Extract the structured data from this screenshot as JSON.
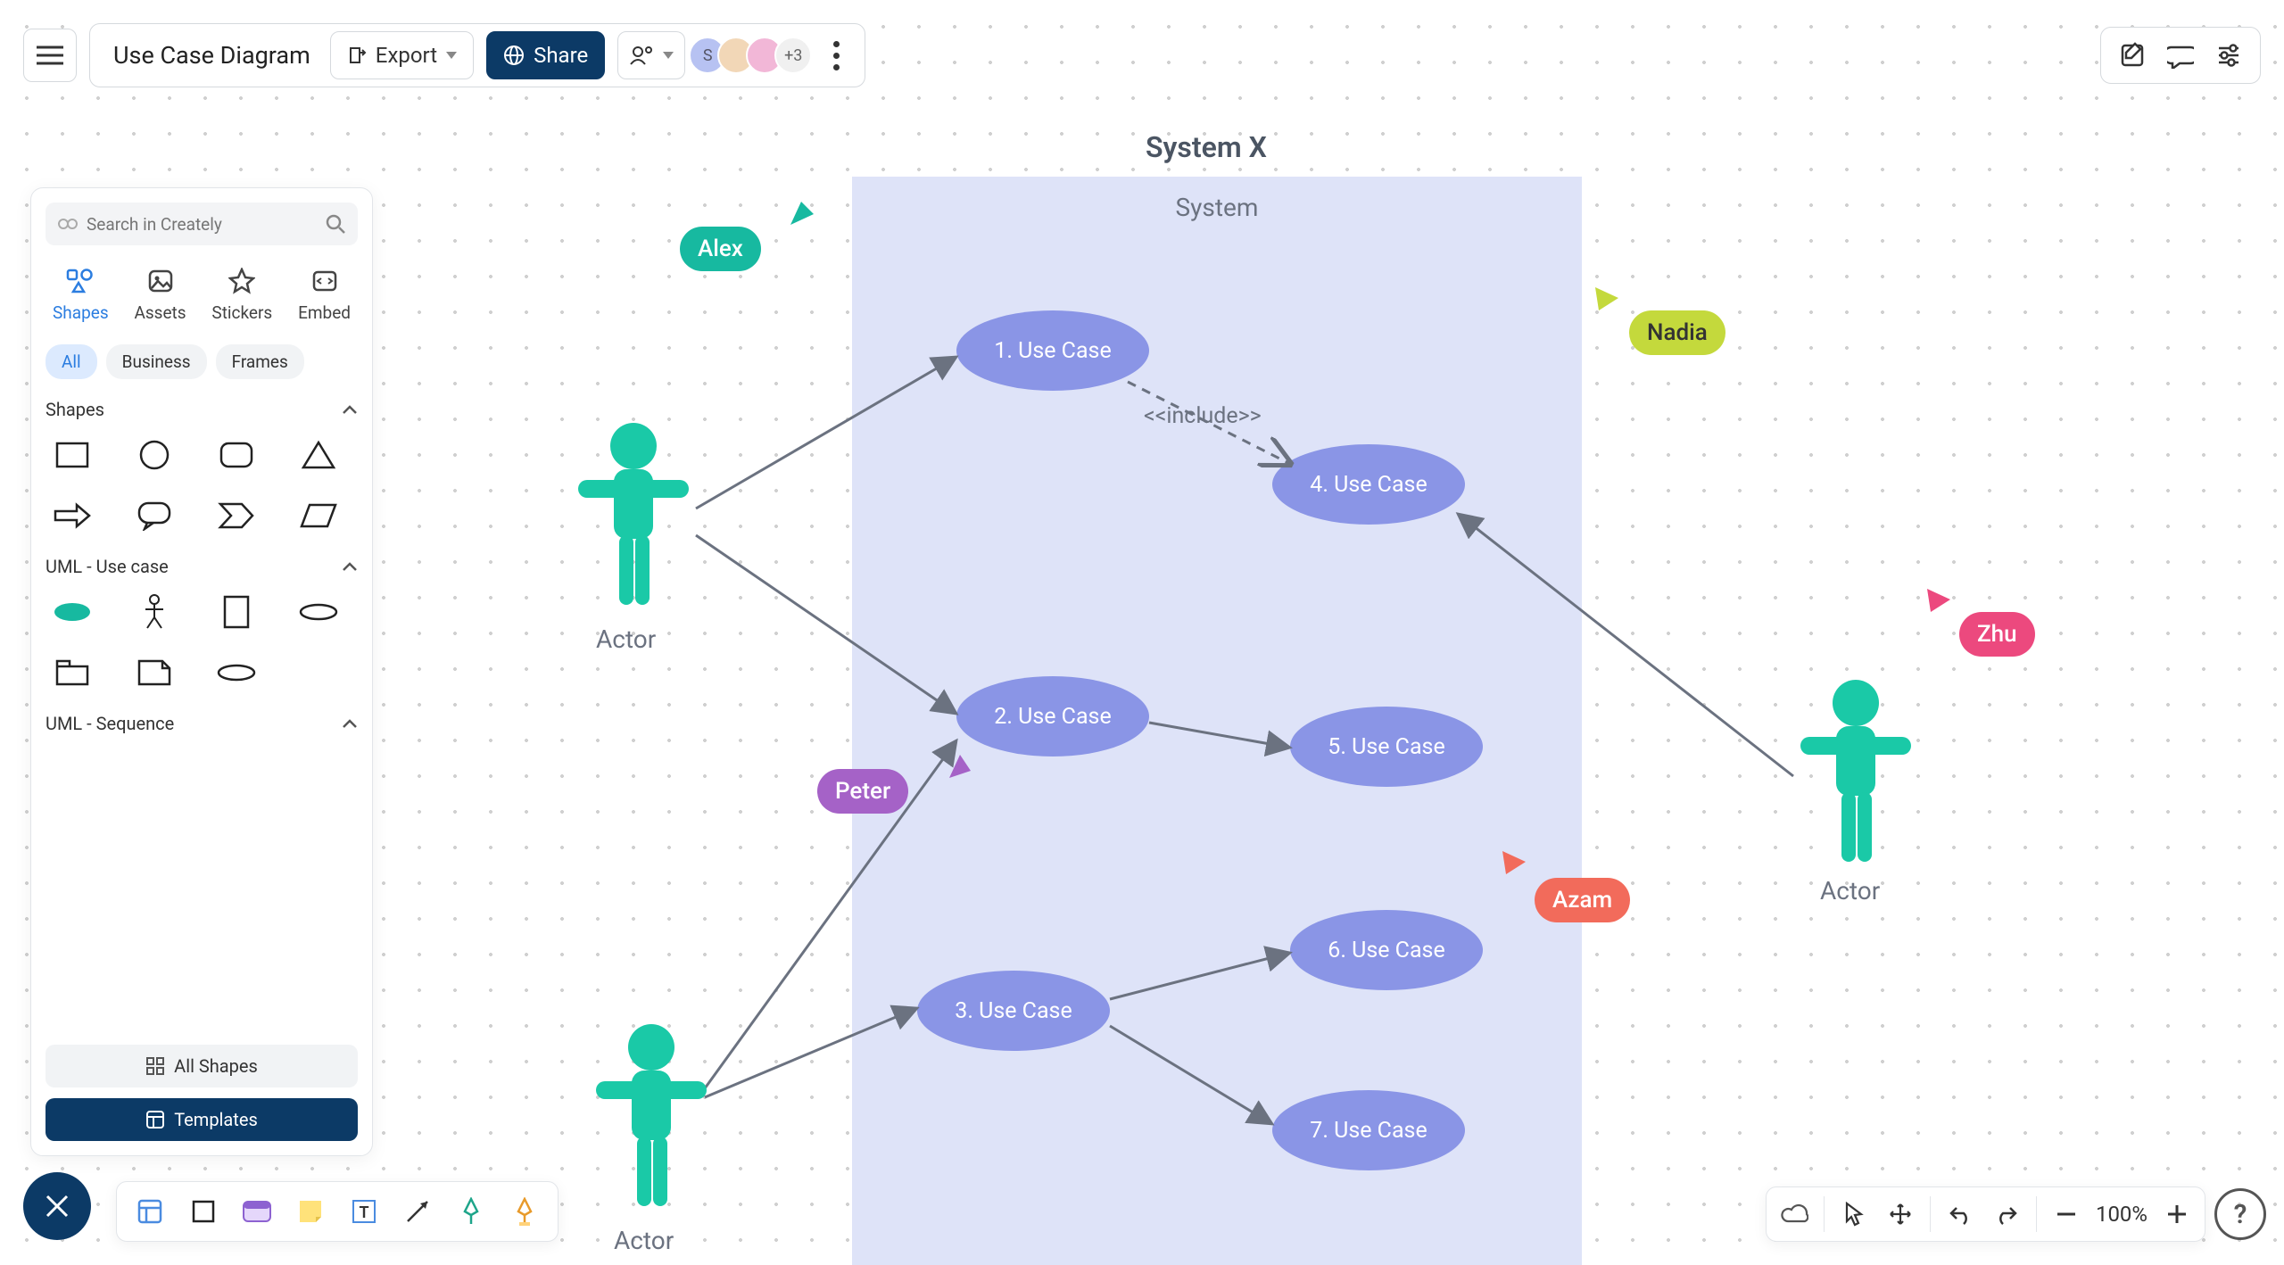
{
  "header": {
    "doc_title": "Use Case Diagram",
    "export_label": "Export",
    "share_label": "Share",
    "invite_label": "Invite",
    "avatars": [
      {
        "letter": "S",
        "color": "#b7c2f2"
      },
      {
        "letter": "",
        "color": "#f2d7b7"
      },
      {
        "letter": "",
        "color": "#f2b7d7"
      }
    ],
    "more_count": "+3"
  },
  "sidebar": {
    "search_placeholder": "Search in Creately",
    "tabs": [
      {
        "label": "Shapes"
      },
      {
        "label": "Assets"
      },
      {
        "label": "Stickers"
      },
      {
        "label": "Embed"
      }
    ],
    "chips": [
      {
        "label": "All",
        "active": true
      },
      {
        "label": "Business"
      },
      {
        "label": "Frames"
      }
    ],
    "section_shapes": "Shapes",
    "section_uml_usecase": "UML - Use case",
    "section_uml_sequence": "UML - Sequence",
    "all_shapes_label": "All Shapes",
    "templates_label": "Templates"
  },
  "diagram": {
    "system_title": "System X",
    "system_label": "System",
    "use_cases": [
      {
        "label": "1. Use Case"
      },
      {
        "label": "2. Use Case"
      },
      {
        "label": "3. Use Case"
      },
      {
        "label": "4. Use Case"
      },
      {
        "label": "5. Use Case"
      },
      {
        "label": "6. Use Case"
      },
      {
        "label": "7. Use Case"
      }
    ],
    "actor_left_top": "Actor",
    "actor_left_bottom": "Actor",
    "actor_right": "Actor",
    "include_label": "<<include>>",
    "cursors": [
      {
        "name": "Alex",
        "color": "#17b9a0"
      },
      {
        "name": "Nadia",
        "color": "#c4d93c"
      },
      {
        "name": "Zhu",
        "color": "#ec497e"
      },
      {
        "name": "Peter",
        "color": "#a562c7"
      },
      {
        "name": "Azam",
        "color": "#f26b5b"
      }
    ]
  },
  "zoom_level": "100%"
}
